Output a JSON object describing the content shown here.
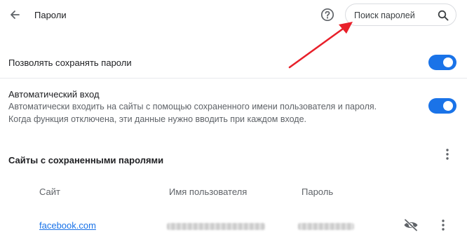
{
  "header": {
    "title": "Пароли",
    "back_icon": "arrow-back-icon",
    "help_icon": "help-circle-icon",
    "search": {
      "placeholder": "Поиск паролей",
      "value": "",
      "icon": "search-icon"
    }
  },
  "settings": {
    "offer_to_save": {
      "label": "Позволять сохранять пароли",
      "enabled": true
    },
    "auto_signin": {
      "label": "Автоматический вход",
      "description_line1": "Автоматически входить на сайты с помощью сохраненного имени пользователя и пароля.",
      "description_line2": "Когда функция отключена, эти данные нужно вводить при каждом входе.",
      "enabled": true
    }
  },
  "saved_passwords": {
    "title": "Сайты с сохраненными паролями",
    "columns": {
      "site": "Сайт",
      "username": "Имя пользователя",
      "password": "Пароль"
    },
    "rows": [
      {
        "site": "facebook.com",
        "username_visible": false,
        "password_visible": false,
        "show_password_icon": "eye-off-icon",
        "more_icon": "more-vert-icon"
      }
    ]
  },
  "colors": {
    "accent": "#1a73e8",
    "annotation": "#e8202a",
    "text_primary": "#202124",
    "text_secondary": "#5f6368"
  }
}
